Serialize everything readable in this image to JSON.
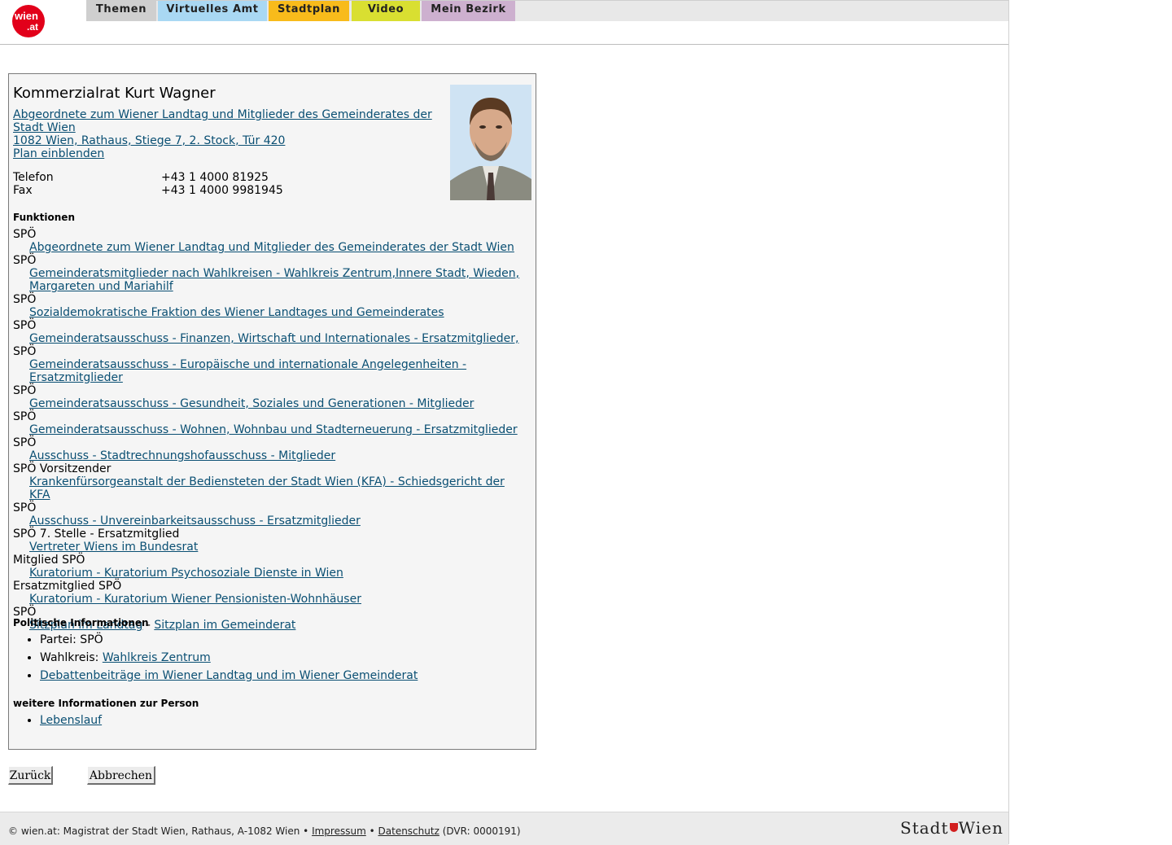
{
  "brand": {
    "logo_text_top": "wien",
    "logo_text_bottom": ".at",
    "stadt_logo_left": "Stadt",
    "stadt_logo_right": "Wien"
  },
  "nav": {
    "tabs": [
      "Themen",
      "Virtuelles Amt",
      "Stadtplan",
      "Video",
      "Mein Bezirk"
    ]
  },
  "person": {
    "name": "Kommerzialrat Kurt Wagner",
    "office_link_line1": "Abgeordnete zum Wiener Landtag und Mitglieder des Gemeinderates der",
    "office_link_line2": "Stadt Wien",
    "address": "1082 Wien, Rathaus, Stiege 7, 2. Stock, Tür 420",
    "map_link": "Plan einblenden",
    "phone_label": "Telefon",
    "phone": "+43 1 4000 81925",
    "fax_label": "Fax",
    "fax": "+43 1 4000 9981945"
  },
  "functions_heading": "Funktionen",
  "functions": [
    {
      "role": "SPÖ",
      "org": "Abgeordnete zum Wiener Landtag und Mitglieder des Gemeinderates der Stadt Wien"
    },
    {
      "role": "SPÖ",
      "org": "Gemeinderatsmitglieder nach Wahlkreisen - Wahlkreis Zentrum,Innere Stadt, Wieden, Margareten und Mariahilf"
    },
    {
      "role": "SPÖ",
      "org": "Sozialdemokratische Fraktion des Wiener Landtages und Gemeinderates"
    },
    {
      "role": "SPÖ",
      "org": "Gemeinderatsausschuss - Finanzen, Wirtschaft und Internationales - Ersatzmitglieder,"
    },
    {
      "role": "SPÖ",
      "org": "Gemeinderatsausschuss - Europäische und internationale Angelegenheiten - Ersatzmitglieder"
    },
    {
      "role": "SPÖ",
      "org": "Gemeinderatsausschuss - Gesundheit, Soziales und Generationen - Mitglieder"
    },
    {
      "role": "SPÖ",
      "org": "Gemeinderatsausschuss - Wohnen, Wohnbau und Stadterneuerung - Ersatzmitglieder"
    },
    {
      "role": "SPÖ",
      "org": "Ausschuss - Stadtrechnungshofausschuss - Mitglieder"
    },
    {
      "role": "SPÖ Vorsitzender",
      "org": "Krankenfürsorgeanstalt der Bediensteten der Stadt Wien (KFA) - Schiedsgericht der KFA"
    },
    {
      "role": "SPÖ",
      "org": "Ausschuss - Unvereinbarkeitsausschuss - Ersatzmitglieder"
    },
    {
      "role": "SPÖ 7. Stelle - Ersatzmitglied",
      "org": "Vertreter Wiens im Bundesrat"
    },
    {
      "role": "Mitglied SPÖ",
      "org": "Kuratorium - Kuratorium Psychosoziale Dienste in Wien"
    },
    {
      "role": "Ersatzmitglied SPÖ",
      "org": "Kuratorium - Kuratorium Wiener Pensionisten-Wohnhäuser"
    }
  ],
  "seating": {
    "role": "SPÖ",
    "link1": "Sitzplan im Landtag",
    "separator": "-",
    "link2": "Sitzplan im Gemeinderat"
  },
  "political": {
    "heading": "Politische Informationen",
    "party_label": "Partei: SPÖ",
    "district_label": "Wahlkreis:",
    "district_link": "Wahlkreis Zentrum",
    "debate_link": "Debattenbeiträge im Wiener Landtag und im Wiener Gemeinderat"
  },
  "more": {
    "heading": "weitere Informationen zur Person",
    "cv_link": "Lebenslauf"
  },
  "buttons": {
    "back": "Zurück",
    "cancel": "Abbrechen"
  },
  "footer": {
    "text": "© wien.at: Magistrat der Stadt Wien, Rathaus, A-1082 Wien •",
    "impressum": "Impressum",
    "bullet": "•",
    "datenschutz": "Datenschutz",
    "dvr": "(DVR: 0000191)"
  }
}
